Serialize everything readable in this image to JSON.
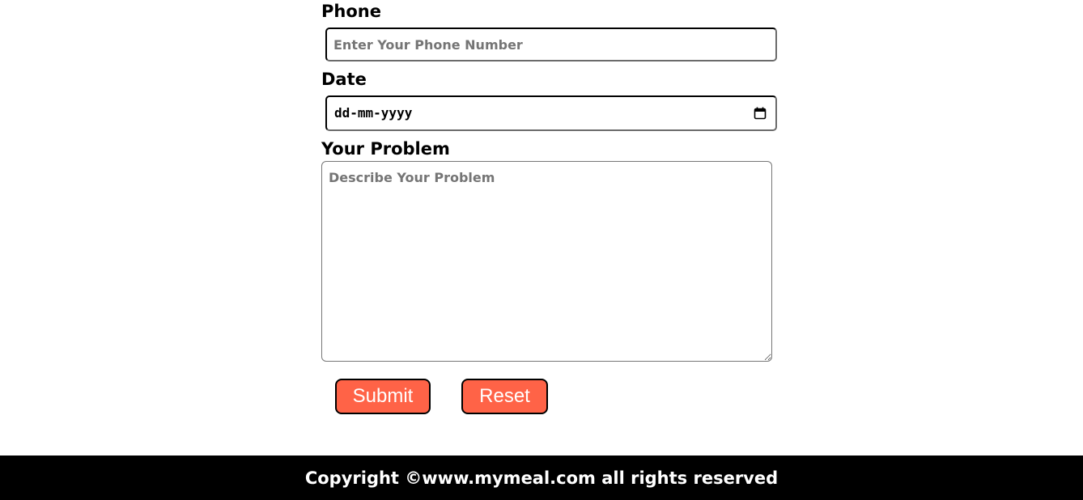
{
  "form": {
    "phone": {
      "label": "Phone",
      "placeholder": "Enter Your Phone Number",
      "value": ""
    },
    "date": {
      "label": "Date",
      "display_value": "dd-mm-yyyy",
      "icon": "calendar-icon"
    },
    "problem": {
      "label": "Your Problem",
      "placeholder": "Describe Your Problem",
      "value": ""
    },
    "buttons": {
      "submit_label": "Submit",
      "reset_label": "Reset",
      "color": "#ff6347"
    }
  },
  "footer": {
    "text": "Copyright ©www.mymeal.com all rights reserved",
    "background": "#000000"
  }
}
